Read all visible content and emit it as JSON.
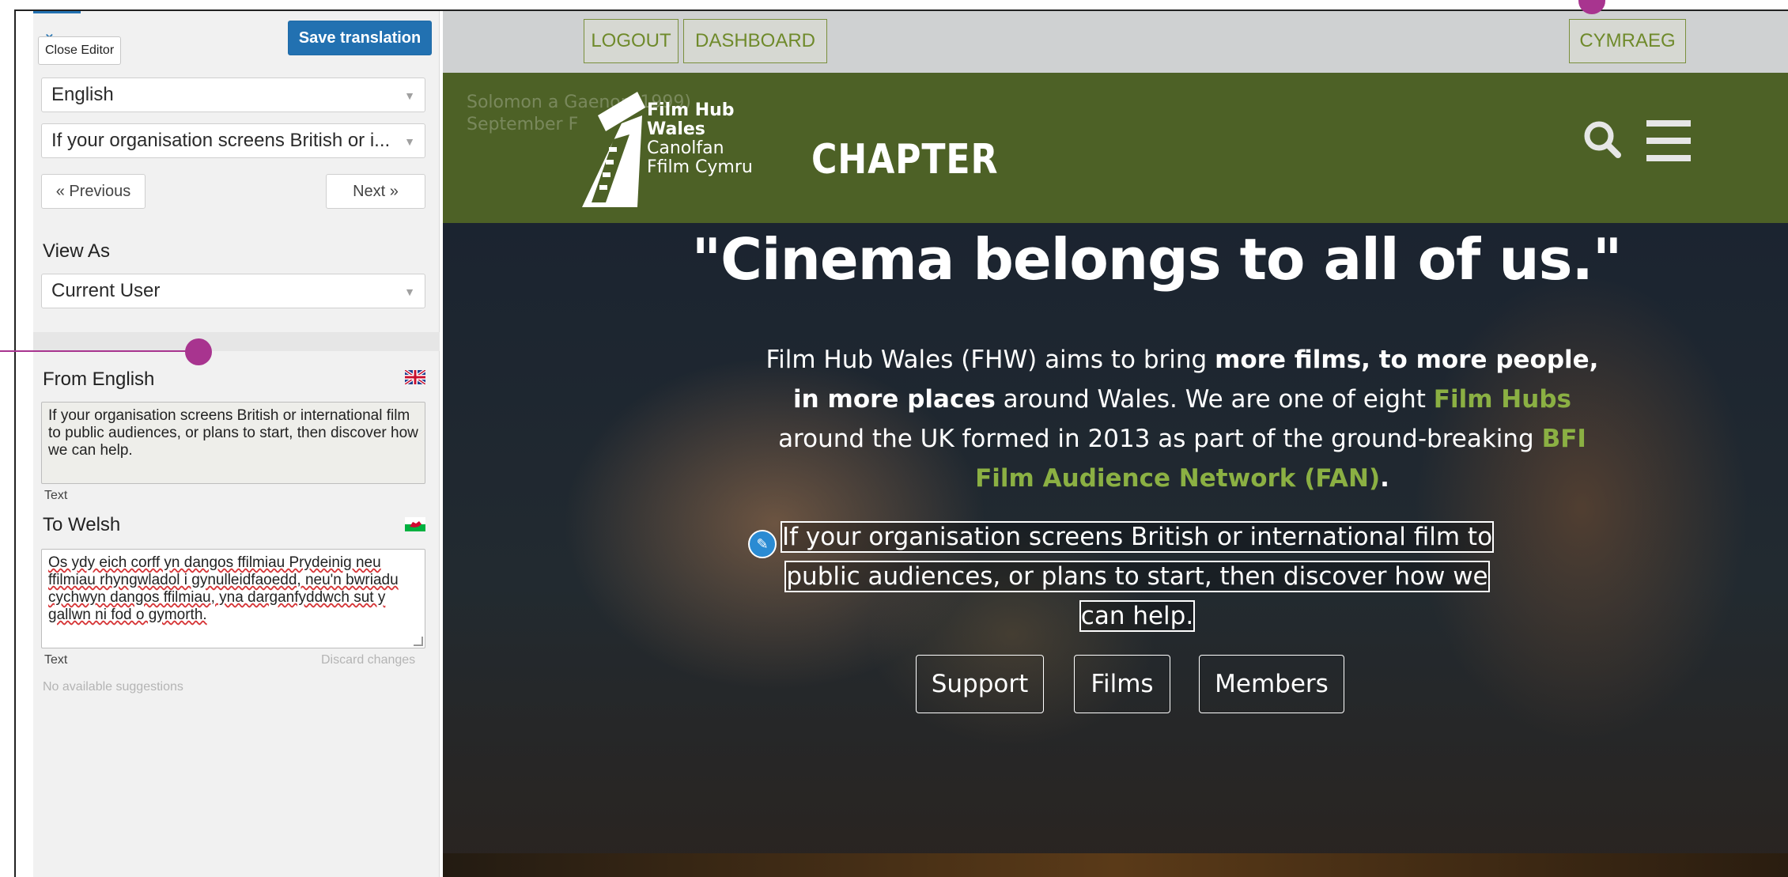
{
  "editor": {
    "close_label": "Close Editor",
    "save_label": "Save translation",
    "language_select": "English",
    "string_select": "If your organisation screens British or i...",
    "prev_label": "« Previous",
    "next_label": "Next »",
    "view_as_label": "View As",
    "view_as_value": "Current User",
    "from_label": "From English",
    "from_text": "If your organisation screens British or international film to public audiences, or plans to start, then discover how we can help.",
    "from_type": "Text",
    "to_label": "To Welsh",
    "to_text": "Os ydy eich corff yn dangos ffilmiau Prydeinig neu ffilmiau rhyngwladol i gynulleidfaoedd, neu'n bwriadu cychwyn dangos ffilmiau, yna darganfyddwch sut y gallwn ni fod o gymorth.",
    "to_type": "Text",
    "discard_label": "Discard changes",
    "suggestions_label": "No available suggestions"
  },
  "preview": {
    "admin": {
      "logout_label": "LOGOUT",
      "dashboard_label": "DASHBOARD",
      "language_label": "CYMRAEG"
    },
    "header": {
      "ghost_line1": "Solomon a Gaenor (1999)",
      "ghost_line2": "September F",
      "logo_line1": "Film Hub",
      "logo_line2": "Wales",
      "logo_line3": "Canolfan",
      "logo_line4": "Ffilm Cymru",
      "partner_logo": "CHAPTER"
    },
    "headline": "\"Cinema belongs to all of us.\"",
    "intro": {
      "part1": "Film Hub Wales (FHW) aims to bring ",
      "bold1": "more films, to more people, in more places",
      "part2": " around Wales. We are one of eight ",
      "link1": "Film Hubs",
      "part3": " around the UK formed in 2013 as part of the ground-breaking ",
      "link2": "BFI Film Audience Network (FAN)",
      "part4": "."
    },
    "editable": {
      "line1": "If your organisation screens British or international film to",
      "line2": "public audiences, or plans to start, then discover how we",
      "line3": "can help."
    },
    "buttons": {
      "support": "Support",
      "films": "Films",
      "members": "Members"
    }
  },
  "colors": {
    "accent_blue": "#2271b1",
    "header_green": "#4d6126",
    "link_green": "#8bb043",
    "callout_purple": "#a8348f"
  }
}
